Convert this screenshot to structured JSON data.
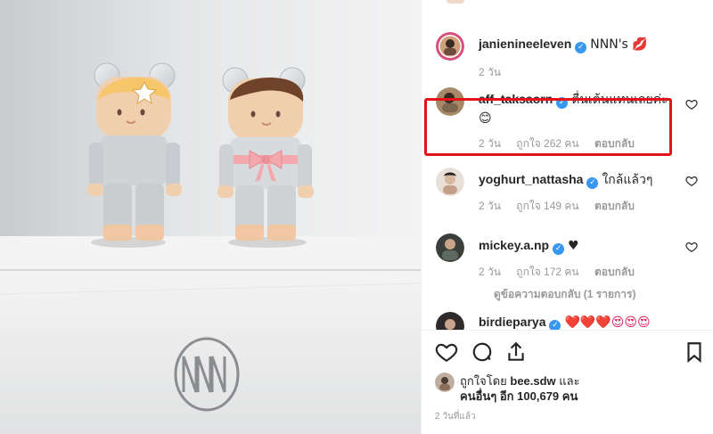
{
  "post": {
    "comments": [
      {
        "username": "janienineeleven",
        "text": "NNN's 💋",
        "time": "2 วัน",
        "likes": "",
        "reply": ""
      },
      {
        "username": "aff_taksaorn",
        "text": "ตื่นเต้นแทนเลยค่ะ",
        "emoji": "😊",
        "time": "2 วัน",
        "likes": "ถูกใจ 262 คน",
        "reply": "ตอบกลับ"
      },
      {
        "username": "yoghurt_nattasha",
        "text": "ใกล้แล้วๆ",
        "time": "2 วัน",
        "likes": "ถูกใจ 149 คน",
        "reply": "ตอบกลับ"
      },
      {
        "username": "mickey.a.np",
        "text": "♥",
        "time": "2 วัน",
        "likes": "ถูกใจ 172 คน",
        "reply": "ตอบกลับ"
      },
      {
        "username": "birdieparya",
        "text": "❤️❤️❤️😍😍😍"
      }
    ],
    "view_replies": "ดูข้อความตอบกลับ (1 รายการ)",
    "likes_summary": {
      "line1_prefix": "ถูกใจโดย",
      "line1_user": "bee.sdw",
      "line1_suffix": "และ",
      "line2": "คนอื่นๆ อีก 100,679 คน"
    },
    "timestamp": "2 วันที่แล้ว",
    "photo": {
      "logo_text": "NNN"
    }
  },
  "icons": {
    "like": "heart-icon",
    "comment": "comment-icon",
    "share": "share-icon",
    "save": "bookmark-icon",
    "comment_like": "heart-icon",
    "verified": "verified-badge-icon"
  },
  "colors": {
    "highlight": "#e2141a",
    "verified": "#3897f0",
    "text": "#262626",
    "meta": "#999999"
  }
}
